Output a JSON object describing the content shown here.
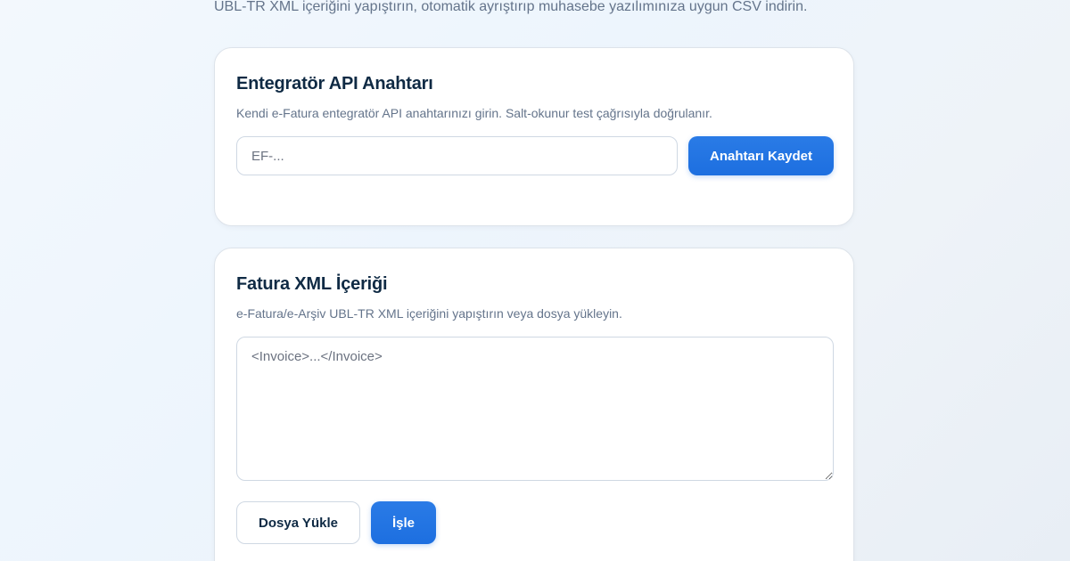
{
  "header": {
    "subtitle": "UBL-TR XML içeriğini yapıştırın, otomatik ayrıştırıp muhasebe yazılımınıza uygun CSV indirin."
  },
  "api_key_card": {
    "title": "Entegratör API Anahtarı",
    "description": "Kendi e-Fatura entegratör API anahtarınızı girin. Salt-okunur test çağrısıyla doğrulanır.",
    "input_value": "",
    "input_placeholder": "EF-...",
    "save_label": "Anahtarı Kaydet"
  },
  "xml_card": {
    "title": "Fatura XML İçeriği",
    "description": "e-Fatura/e-Arşiv UBL-TR XML içeriğini yapıştırın veya dosya yükleyin.",
    "textarea_value": "",
    "textarea_placeholder": "<Invoice>...</Invoice>",
    "upload_label": "Dosya Yükle",
    "process_label": "İşle"
  },
  "colors": {
    "primary": "#1d6fe0",
    "heading": "#0f2a44",
    "muted": "#64748b",
    "border": "#cfd8e3"
  }
}
